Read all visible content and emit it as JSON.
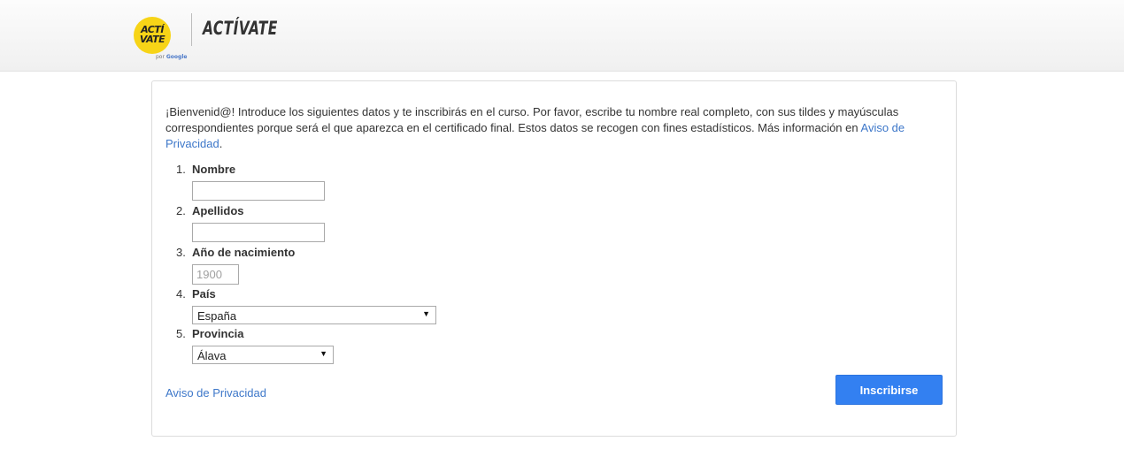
{
  "header": {
    "logo_line1": "ACTÍ",
    "logo_line2": "VATE",
    "logo_sub_prefix": "por",
    "logo_sub_brand": "Google",
    "title": "ACTÍVATE",
    "brand_color": "#f7d417"
  },
  "intro": {
    "text": "¡Bienvenid@! Introduce los siguientes datos y te inscribirás en el curso. Por favor, escribe tu nombre real completo, con sus tildes y mayúsculas correspondientes porque será el que aparezca en el certificado final. Estos datos se recogen con fines estadísticos. Más información en ",
    "link": "Aviso de Privacidad",
    "tail": "."
  },
  "fields": [
    {
      "num": "1.",
      "label": "Nombre",
      "value": "",
      "placeholder": ""
    },
    {
      "num": "2.",
      "label": "Apellidos",
      "value": "",
      "placeholder": ""
    },
    {
      "num": "3.",
      "label": "Año de nacimiento",
      "value": "",
      "placeholder": "1900"
    },
    {
      "num": "4.",
      "label": "País",
      "selected": "España"
    },
    {
      "num": "5.",
      "label": "Provincia",
      "selected": "Álava"
    }
  ],
  "footer": {
    "privacy_link": "Aviso de Privacidad",
    "submit": "Inscribirse",
    "accent_color": "#3380f1"
  }
}
